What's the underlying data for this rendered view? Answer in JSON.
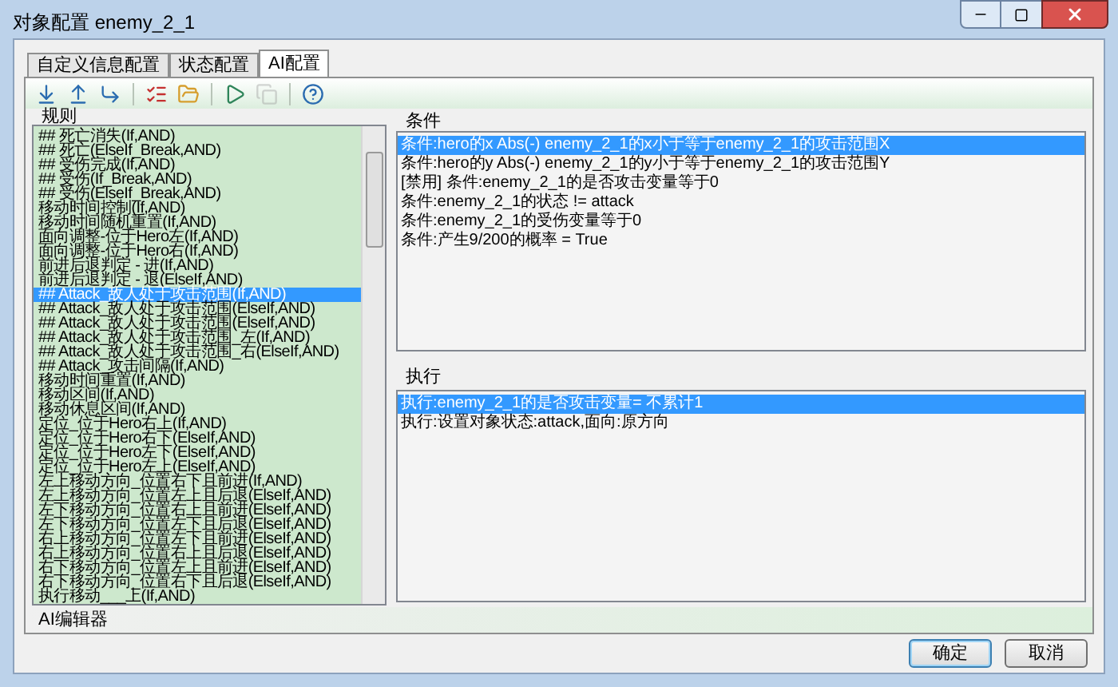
{
  "window": {
    "title": "对象配置 enemy_2_1"
  },
  "tabs": [
    {
      "label": "自定义信息配置",
      "selected": false
    },
    {
      "label": "状态配置",
      "selected": false
    },
    {
      "label": "AI配置",
      "selected": true
    }
  ],
  "toolbar": [
    [
      {
        "disabled": false
      },
      {
        "disabled": false
      },
      {
        "disabled": false
      }
    ],
    [
      {
        "disabled": false
      },
      {
        "disabled": false
      }
    ],
    [
      {
        "disabled": false
      },
      {
        "disabled": true
      }
    ],
    [
      {
        "disabled": false
      }
    ]
  ],
  "rules": {
    "title": "规则",
    "items": [
      {
        "text": "## 死亡消失(If,AND)",
        "selected": false
      },
      {
        "text": "## 死亡(ElseIf_Break,AND)",
        "selected": false
      },
      {
        "text": "## 受伤完成(If,AND)",
        "selected": false
      },
      {
        "text": "## 受伤(If_Break,AND)",
        "selected": false
      },
      {
        "text": "## 受伤(ElseIf_Break,AND)",
        "selected": false
      },
      {
        "text": "移动时间控制(If,AND)",
        "selected": false
      },
      {
        "text": "移动时间随机重置(If,AND)",
        "selected": false
      },
      {
        "text": "面向调整-位于Hero左(If,AND)",
        "selected": false
      },
      {
        "text": "面向调整-位于Hero右(If,AND)",
        "selected": false
      },
      {
        "text": "前进后退判定 - 进(If,AND)",
        "selected": false
      },
      {
        "text": "前进后退判定 - 退(ElseIf,AND)",
        "selected": false
      },
      {
        "text": "## Attack_敌人处于攻击范围(If,AND)",
        "selected": true
      },
      {
        "text": "## Attack_敌人处于攻击范围(ElseIf,AND)",
        "selected": false
      },
      {
        "text": "## Attack_敌人处于攻击范围(ElseIf,AND)",
        "selected": false
      },
      {
        "text": "## Attack_敌人处于攻击范围_左(If,AND)",
        "selected": false
      },
      {
        "text": "## Attack_敌人处于攻击范围_右(ElseIf,AND)",
        "selected": false
      },
      {
        "text": "## Attack_攻击间隔(If,AND)",
        "selected": false
      },
      {
        "text": "移动时间重置(If,AND)",
        "selected": false
      },
      {
        "text": "移动区间(If,AND)",
        "selected": false
      },
      {
        "text": "移动休息区间(If,AND)",
        "selected": false
      },
      {
        "text": "定位_位于Hero右上(If,AND)",
        "selected": false
      },
      {
        "text": "定位_位于Hero右下(ElseIf,AND)",
        "selected": false
      },
      {
        "text": "定位_位于Hero左下(ElseIf,AND)",
        "selected": false
      },
      {
        "text": "定位_位于Hero左上(ElseIf,AND)",
        "selected": false
      },
      {
        "text": "左上移动方向_位置右下且前进(If,AND)",
        "selected": false
      },
      {
        "text": "左上移动方向_位置左上且后退(ElseIf,AND)",
        "selected": false
      },
      {
        "text": "左下移动方向_位置右上且前进(ElseIf,AND)",
        "selected": false
      },
      {
        "text": "左下移动方向_位置左下且后退(ElseIf,AND)",
        "selected": false
      },
      {
        "text": "右上移动方向_位置左下且前进(ElseIf,AND)",
        "selected": false
      },
      {
        "text": "右上移动方向_位置右上且后退(ElseIf,AND)",
        "selected": false
      },
      {
        "text": "右下移动方向_位置左上且前进(ElseIf,AND)",
        "selected": false
      },
      {
        "text": "右下移动方向_位置右下且后退(ElseIf,AND)",
        "selected": false
      },
      {
        "text": "执行移动___上(If,AND)",
        "selected": false
      }
    ]
  },
  "conditions": {
    "title": "条件",
    "items": [
      {
        "text": "条件:hero的x Abs(-) enemy_2_1的x小于等于enemy_2_1的攻击范围X",
        "selected": true
      },
      {
        "text": "条件:hero的y Abs(-) enemy_2_1的y小于等于enemy_2_1的攻击范围Y",
        "selected": false
      },
      {
        "text": "[禁用] 条件:enemy_2_1的是否攻击变量等于0",
        "selected": false
      },
      {
        "text": "条件:enemy_2_1的状态 != attack",
        "selected": false
      },
      {
        "text": "条件:enemy_2_1的受伤变量等于0",
        "selected": false
      },
      {
        "text": "条件:产生9/200的概率 = True",
        "selected": false
      }
    ]
  },
  "actions": {
    "title": "执行",
    "items": [
      {
        "text": "执行:enemy_2_1的是否攻击变量= 不累计1",
        "selected": true
      },
      {
        "text": "执行:设置对象状态:attack,面向:原方向",
        "selected": false
      }
    ]
  },
  "status_bar": "AI编辑器",
  "buttons": [
    {
      "label": "确定",
      "default": true
    },
    {
      "label": "取消",
      "default": false
    }
  ]
}
